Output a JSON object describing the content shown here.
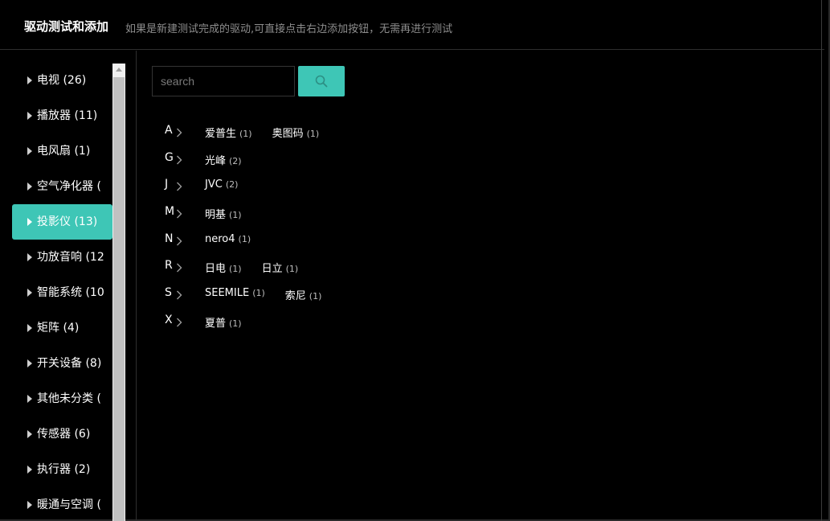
{
  "header": {
    "title": "驱动测试和添加",
    "subtitle": "如果是新建测试完成的驱动,可直接点击右边添加按钮，无需再进行测试"
  },
  "sidebar": {
    "items": [
      {
        "label": "电视 (26)",
        "active": false
      },
      {
        "label": "播放器 (11)",
        "active": false
      },
      {
        "label": "电风扇 (1)",
        "active": false
      },
      {
        "label": "空气净化器 (",
        "active": false
      },
      {
        "label": "投影仪 (13)",
        "active": true
      },
      {
        "label": "功放音响 (12",
        "active": false
      },
      {
        "label": "智能系统 (10",
        "active": false
      },
      {
        "label": "矩阵 (4)",
        "active": false
      },
      {
        "label": "开关设备 (8)",
        "active": false
      },
      {
        "label": "其他未分类 (",
        "active": false
      },
      {
        "label": "传感器 (6)",
        "active": false
      },
      {
        "label": "执行器 (2)",
        "active": false
      },
      {
        "label": "暖通与空调 (",
        "active": false
      }
    ]
  },
  "search": {
    "placeholder": "search",
    "value": "",
    "button_icon": "search-icon"
  },
  "groups": [
    {
      "letter": "A",
      "brands": [
        {
          "name": "爱普生",
          "count": "(1)"
        },
        {
          "name": "奥图码",
          "count": "(1)"
        }
      ]
    },
    {
      "letter": "G",
      "brands": [
        {
          "name": "光峰",
          "count": "(2)"
        }
      ]
    },
    {
      "letter": "J",
      "brands": [
        {
          "name": "JVC",
          "count": "(2)"
        }
      ]
    },
    {
      "letter": "M",
      "brands": [
        {
          "name": "明基",
          "count": "(1)"
        }
      ]
    },
    {
      "letter": "N",
      "brands": [
        {
          "name": "nero4",
          "count": "(1)"
        }
      ]
    },
    {
      "letter": "R",
      "brands": [
        {
          "name": "日电",
          "count": "(1)"
        },
        {
          "name": "日立",
          "count": "(1)"
        }
      ]
    },
    {
      "letter": "S",
      "brands": [
        {
          "name": "SEEMILE",
          "count": "(1)"
        },
        {
          "name": "索尼",
          "count": "(1)"
        }
      ]
    },
    {
      "letter": "X",
      "brands": [
        {
          "name": "夏普",
          "count": "(1)"
        }
      ]
    }
  ],
  "colors": {
    "accent": "#3ec6b6",
    "background": "#000000",
    "muted_text": "#8d8d8d"
  }
}
